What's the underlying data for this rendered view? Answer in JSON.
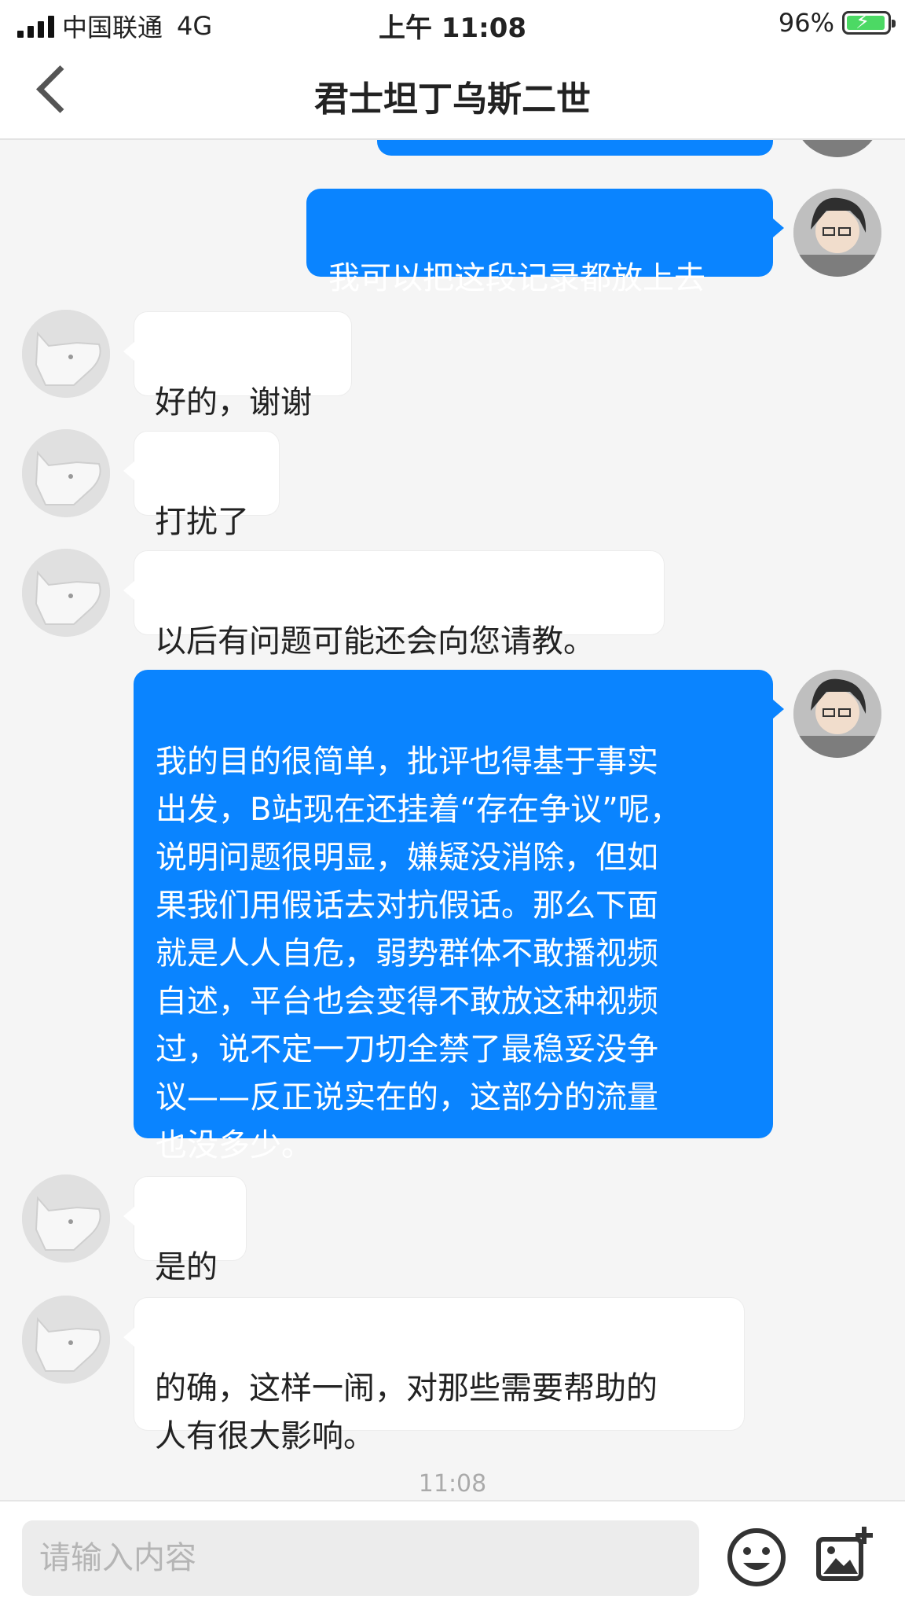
{
  "status_bar": {
    "carrier": "中国联通",
    "network": "4G",
    "time": "上午 11:08",
    "battery": "96%",
    "battery_level": 0.96,
    "battery_color": "#4cd964"
  },
  "nav": {
    "back_icon": "chevron-left-icon",
    "title": "君士坦丁乌斯二世"
  },
  "colors": {
    "my_bubble": "#0a84ff",
    "other_bubble": "#ffffff",
    "background": "#f5f5f5"
  },
  "messages": [
    {
      "sender": "me",
      "text": ""
    },
    {
      "sender": "me",
      "text": "我可以把这段记录都放上去"
    },
    {
      "sender": "other",
      "text": "好的，谢谢"
    },
    {
      "sender": "other",
      "text": "打扰了"
    },
    {
      "sender": "other",
      "text": "以后有问题可能还会向您请教。"
    },
    {
      "sender": "me",
      "text": "我的目的很简单，批评也得基于事实\n出发，B站现在还挂着“存在争议”呢，\n说明问题很明显，嫌疑没消除，但如\n果我们用假话去对抗假话。那么下面\n就是人人自危，弱势群体不敢播视频\n自述，平台也会变得不敢放这种视频\n过，说不定一刀切全禁了最稳妥没争\n议——反正说实在的，这部分的流量\n也没多少。"
    },
    {
      "sender": "other",
      "text": "是的"
    },
    {
      "sender": "other",
      "text": "的确，这样一闹，对那些需要帮助的\n人有很大影响。"
    }
  ],
  "timestamp": "11:08",
  "input": {
    "placeholder": "请输入内容",
    "value": ""
  },
  "toolbar": {
    "emoji_icon": "emoji-icon",
    "image_icon": "add-image-icon"
  }
}
